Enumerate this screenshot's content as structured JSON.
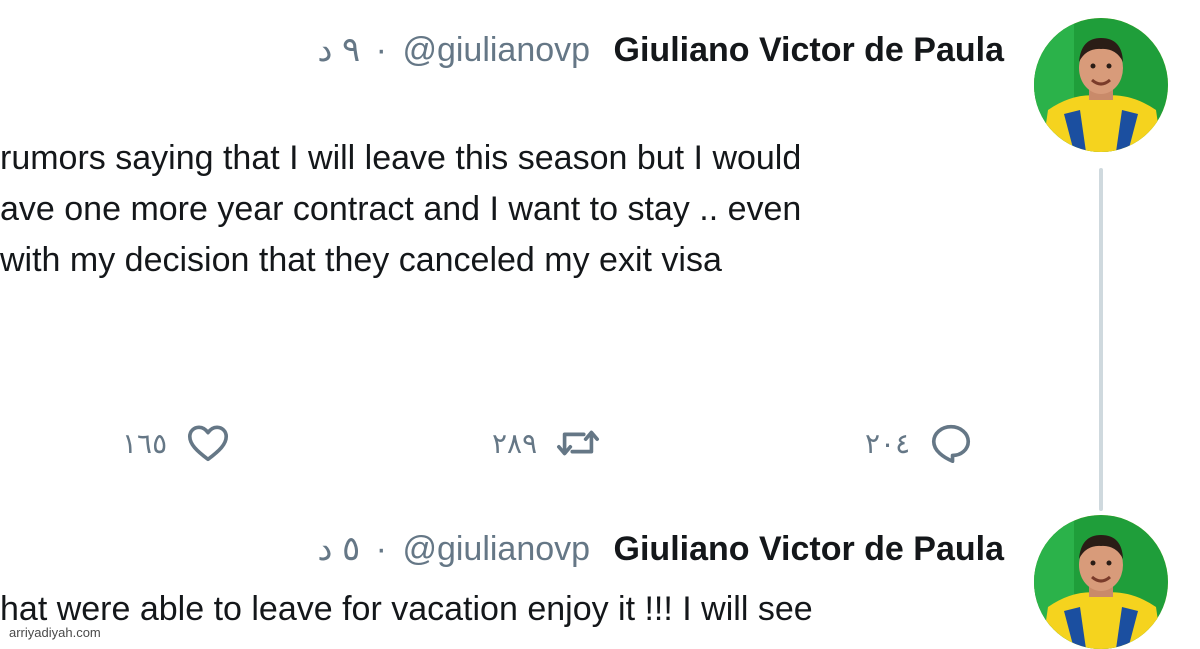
{
  "tweets": [
    {
      "author_name": "Giuliano Victor de Paula",
      "handle": "@giulianovp",
      "separator": "·",
      "time": "٩ د",
      "text_lines": [
        "rumors saying that I will leave this season but I would",
        "ave one more year contract and I want to stay .. even",
        "with my decision that they canceled my exit visa"
      ],
      "stats": {
        "likes": "١٦٥",
        "retweets": "٢٨٩",
        "replies": "٢٠٤"
      }
    },
    {
      "author_name": "Giuliano Victor de Paula",
      "handle": "@giulianovp",
      "separator": "·",
      "time": "٥ د",
      "text_lines": [
        "hat were able to leave for vacation enjoy it !!! I will see"
      ]
    }
  ],
  "watermark": "arriyadiyah.com",
  "colors": {
    "text": "#14171a",
    "muted": "#657786",
    "thread_line": "#cfd9de",
    "avatar_jersey": "#f5d31e",
    "avatar_background": "#1f9e3a"
  },
  "icons": {
    "like": "heart-icon",
    "retweet": "retweet-icon",
    "reply": "reply-icon"
  }
}
